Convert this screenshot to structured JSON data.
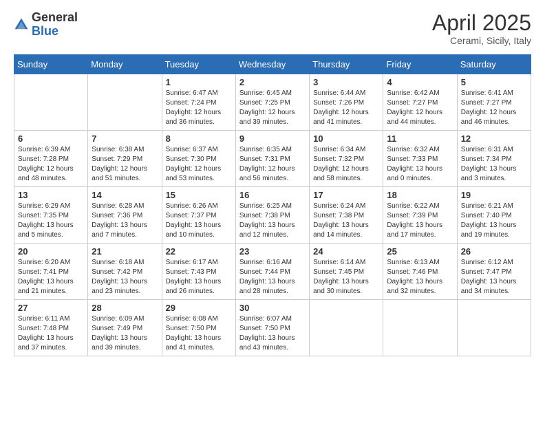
{
  "logo": {
    "general": "General",
    "blue": "Blue"
  },
  "header": {
    "title": "April 2025",
    "subtitle": "Cerami, Sicily, Italy"
  },
  "days_of_week": [
    "Sunday",
    "Monday",
    "Tuesday",
    "Wednesday",
    "Thursday",
    "Friday",
    "Saturday"
  ],
  "weeks": [
    [
      {
        "day": "",
        "info": ""
      },
      {
        "day": "",
        "info": ""
      },
      {
        "day": "1",
        "sunrise": "6:47 AM",
        "sunset": "7:24 PM",
        "daylight": "12 hours and 36 minutes."
      },
      {
        "day": "2",
        "sunrise": "6:45 AM",
        "sunset": "7:25 PM",
        "daylight": "12 hours and 39 minutes."
      },
      {
        "day": "3",
        "sunrise": "6:44 AM",
        "sunset": "7:26 PM",
        "daylight": "12 hours and 41 minutes."
      },
      {
        "day": "4",
        "sunrise": "6:42 AM",
        "sunset": "7:27 PM",
        "daylight": "12 hours and 44 minutes."
      },
      {
        "day": "5",
        "sunrise": "6:41 AM",
        "sunset": "7:27 PM",
        "daylight": "12 hours and 46 minutes."
      }
    ],
    [
      {
        "day": "6",
        "sunrise": "6:39 AM",
        "sunset": "7:28 PM",
        "daylight": "12 hours and 48 minutes."
      },
      {
        "day": "7",
        "sunrise": "6:38 AM",
        "sunset": "7:29 PM",
        "daylight": "12 hours and 51 minutes."
      },
      {
        "day": "8",
        "sunrise": "6:37 AM",
        "sunset": "7:30 PM",
        "daylight": "12 hours and 53 minutes."
      },
      {
        "day": "9",
        "sunrise": "6:35 AM",
        "sunset": "7:31 PM",
        "daylight": "12 hours and 56 minutes."
      },
      {
        "day": "10",
        "sunrise": "6:34 AM",
        "sunset": "7:32 PM",
        "daylight": "12 hours and 58 minutes."
      },
      {
        "day": "11",
        "sunrise": "6:32 AM",
        "sunset": "7:33 PM",
        "daylight": "13 hours and 0 minutes."
      },
      {
        "day": "12",
        "sunrise": "6:31 AM",
        "sunset": "7:34 PM",
        "daylight": "13 hours and 3 minutes."
      }
    ],
    [
      {
        "day": "13",
        "sunrise": "6:29 AM",
        "sunset": "7:35 PM",
        "daylight": "13 hours and 5 minutes."
      },
      {
        "day": "14",
        "sunrise": "6:28 AM",
        "sunset": "7:36 PM",
        "daylight": "13 hours and 7 minutes."
      },
      {
        "day": "15",
        "sunrise": "6:26 AM",
        "sunset": "7:37 PM",
        "daylight": "13 hours and 10 minutes."
      },
      {
        "day": "16",
        "sunrise": "6:25 AM",
        "sunset": "7:38 PM",
        "daylight": "13 hours and 12 minutes."
      },
      {
        "day": "17",
        "sunrise": "6:24 AM",
        "sunset": "7:38 PM",
        "daylight": "13 hours and 14 minutes."
      },
      {
        "day": "18",
        "sunrise": "6:22 AM",
        "sunset": "7:39 PM",
        "daylight": "13 hours and 17 minutes."
      },
      {
        "day": "19",
        "sunrise": "6:21 AM",
        "sunset": "7:40 PM",
        "daylight": "13 hours and 19 minutes."
      }
    ],
    [
      {
        "day": "20",
        "sunrise": "6:20 AM",
        "sunset": "7:41 PM",
        "daylight": "13 hours and 21 minutes."
      },
      {
        "day": "21",
        "sunrise": "6:18 AM",
        "sunset": "7:42 PM",
        "daylight": "13 hours and 23 minutes."
      },
      {
        "day": "22",
        "sunrise": "6:17 AM",
        "sunset": "7:43 PM",
        "daylight": "13 hours and 26 minutes."
      },
      {
        "day": "23",
        "sunrise": "6:16 AM",
        "sunset": "7:44 PM",
        "daylight": "13 hours and 28 minutes."
      },
      {
        "day": "24",
        "sunrise": "6:14 AM",
        "sunset": "7:45 PM",
        "daylight": "13 hours and 30 minutes."
      },
      {
        "day": "25",
        "sunrise": "6:13 AM",
        "sunset": "7:46 PM",
        "daylight": "13 hours and 32 minutes."
      },
      {
        "day": "26",
        "sunrise": "6:12 AM",
        "sunset": "7:47 PM",
        "daylight": "13 hours and 34 minutes."
      }
    ],
    [
      {
        "day": "27",
        "sunrise": "6:11 AM",
        "sunset": "7:48 PM",
        "daylight": "13 hours and 37 minutes."
      },
      {
        "day": "28",
        "sunrise": "6:09 AM",
        "sunset": "7:49 PM",
        "daylight": "13 hours and 39 minutes."
      },
      {
        "day": "29",
        "sunrise": "6:08 AM",
        "sunset": "7:50 PM",
        "daylight": "13 hours and 41 minutes."
      },
      {
        "day": "30",
        "sunrise": "6:07 AM",
        "sunset": "7:50 PM",
        "daylight": "13 hours and 43 minutes."
      },
      {
        "day": "",
        "info": ""
      },
      {
        "day": "",
        "info": ""
      },
      {
        "day": "",
        "info": ""
      }
    ]
  ]
}
